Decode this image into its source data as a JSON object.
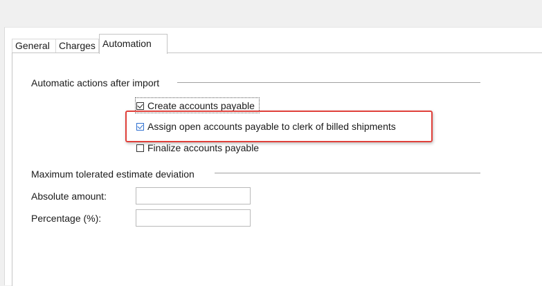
{
  "tabs": [
    {
      "label": "General",
      "active": false
    },
    {
      "label": "Charges",
      "active": false
    },
    {
      "label": "Automation",
      "active": true
    }
  ],
  "automatic_actions": {
    "title": "Automatic actions after import",
    "options": [
      {
        "label": "Create accounts payable",
        "checked": true
      },
      {
        "label": "Assign open accounts payable to clerk of billed shipments",
        "checked": true,
        "highlighted": true
      },
      {
        "label": "Finalize accounts payable",
        "checked": false
      }
    ]
  },
  "deviation": {
    "title": "Maximum tolerated estimate deviation",
    "absolute_label": "Absolute amount:",
    "absolute_value": "",
    "percentage_label": "Percentage (%):",
    "percentage_value": ""
  },
  "colors": {
    "highlight_border": "#e0403a",
    "checkbox_accent": "#2d6fd0"
  }
}
